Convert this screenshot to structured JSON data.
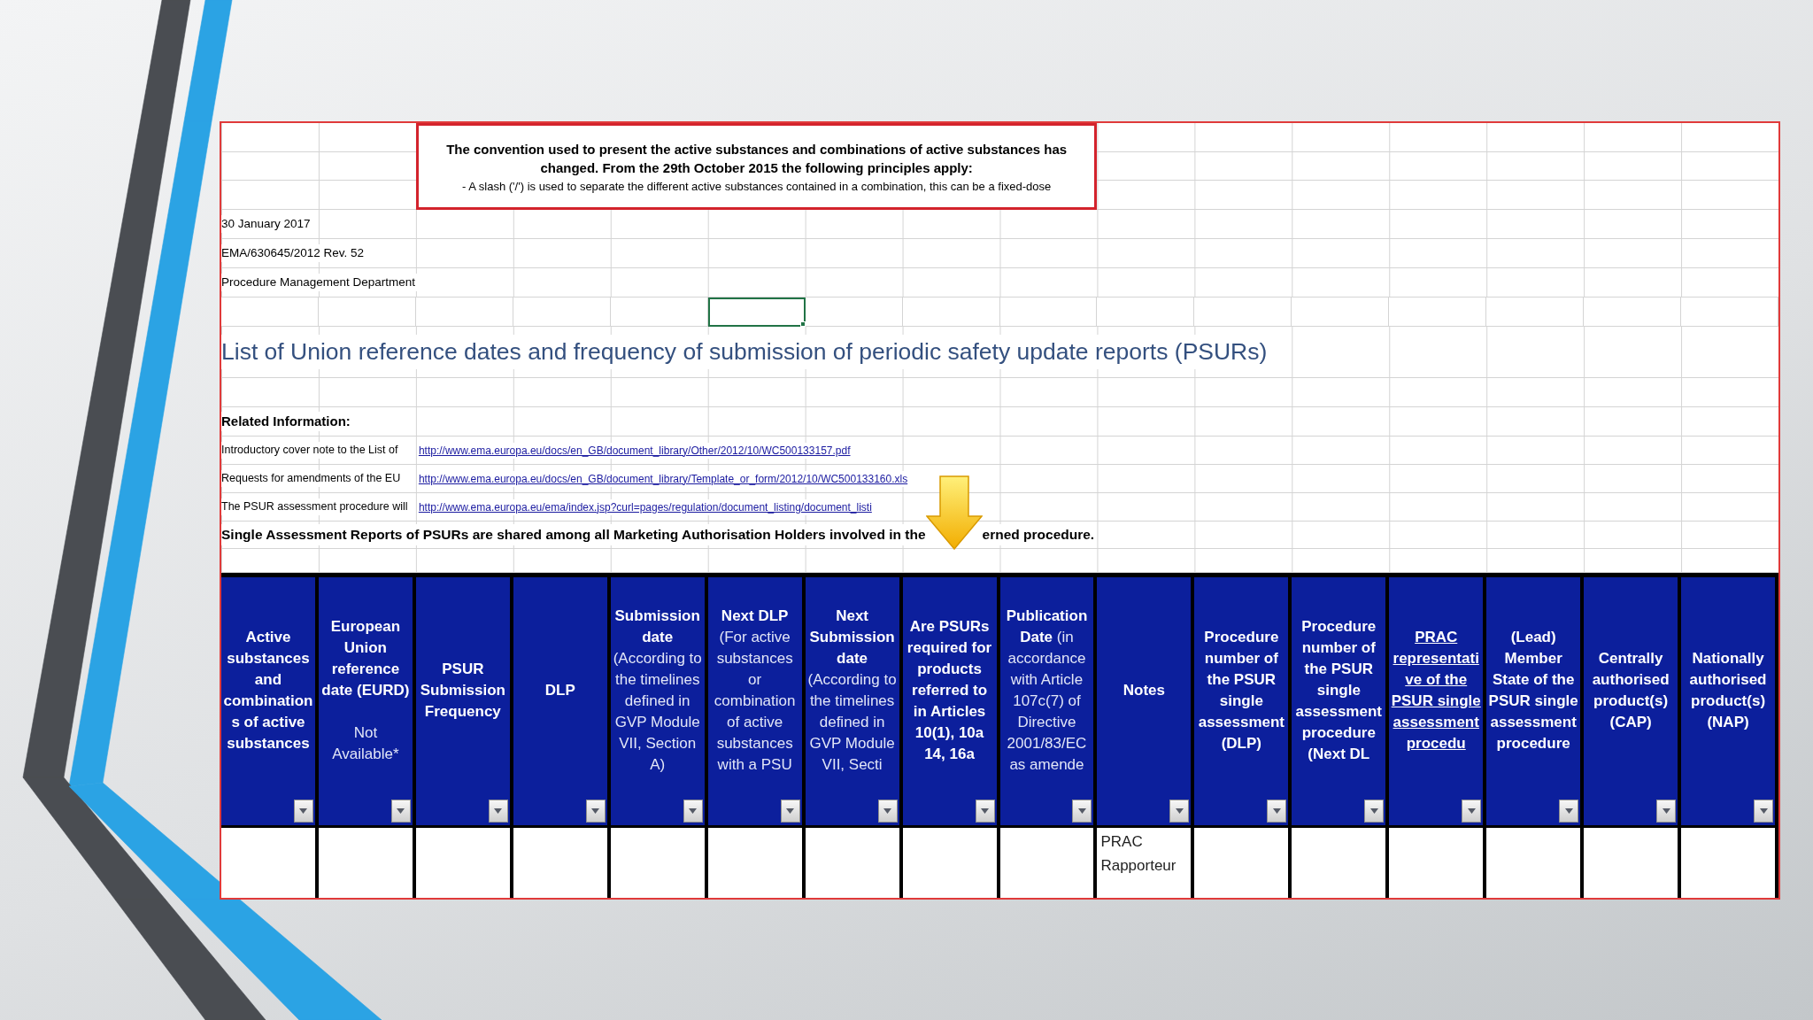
{
  "banner": {
    "heading": "The convention used to present the active substances and combinations of active substances has changed. From the 29th October 2015 the following principles apply:",
    "principle": "- A slash ('/') is used to separate the different active substances contained in a combination, this can be a fixed-dose"
  },
  "document_info": [
    "30 January 2017",
    "EMA/630645/2012 Rev. 52",
    "Procedure Management Department"
  ],
  "cursor_row": {
    "cells": [
      {
        "selected": false
      },
      {
        "selected": false
      },
      {
        "selected": false
      },
      {
        "selected": false
      },
      {
        "selected": false
      },
      {
        "selected": true
      },
      {
        "selected": false
      },
      {
        "selected": false
      },
      {
        "selected": false
      },
      {
        "selected": false
      },
      {
        "selected": false
      },
      {
        "selected": false
      },
      {
        "selected": false
      },
      {
        "selected": false
      },
      {
        "selected": false
      },
      {
        "selected": false
      }
    ]
  },
  "title": "List of Union reference dates and frequency of submission of periodic safety update reports (PSURs)",
  "related_information": {
    "heading": "Related Information:",
    "links": [
      {
        "label": "Introductory cover note to the List of",
        "url": "http://www.ema.europa.eu/docs/en_GB/document_library/Other/2012/10/WC500133157.pdf"
      },
      {
        "label": "Requests for amendments of the EU",
        "url": "http://www.ema.europa.eu/docs/en_GB/document_library/Template_or_form/2012/10/WC500133160.xls"
      },
      {
        "label": "The PSUR assessment procedure will",
        "url": "http://www.ema.europa.eu/ema/index.jsp?curl=pages/regulation/document_listing/document_listi"
      }
    ],
    "notice_segments": [
      "Single Assessment Reports of PSURs are shared among all Marketing Authorisation Holders involved in the",
      "erned procedure."
    ]
  },
  "table": {
    "columns": [
      {
        "title": "Active substances and combinations of active substances",
        "underlined": false
      },
      {
        "title": "European Union reference date (EURD)",
        "note": "Not Available*",
        "underlined": false
      },
      {
        "title": "PSUR Submission Frequency",
        "underlined": false
      },
      {
        "title": "DLP",
        "underlined": false
      },
      {
        "title": "Submission date",
        "detail": "(According to the timelines defined in GVP Module VII, Section A)",
        "underlined": false
      },
      {
        "title": "Next DLP",
        "detail": "(For active substances or combination of active substances with a PSU",
        "underlined": false
      },
      {
        "title": "Next Submission date",
        "detail": "(According to the timelines defined in GVP Module VII, Secti",
        "underlined": false
      },
      {
        "title": "Are PSURs required for products referred to in Articles 10(1), 10a 14, 16a",
        "underlined": false
      },
      {
        "title": "Publication Date",
        "detail": "(in accordance with Article 107c(7) of Directive 2001/83/EC as amende",
        "underlined": false
      },
      {
        "title": "Notes",
        "underlined": false
      },
      {
        "title": "Procedure number of the PSUR single assessment (DLP)",
        "underlined": false
      },
      {
        "title": "Procedure number of the PSUR single assessment procedure (Next DL",
        "underlined": false
      },
      {
        "title": "PRAC representative of the PSUR single assessment procedu",
        "underlined": true
      },
      {
        "title": "(Lead) Member State of the PSUR single assessment procedure",
        "underlined": false
      },
      {
        "title": "Centrally authorised product(s) (CAP)",
        "underlined": false
      },
      {
        "title": "Nationally authorised product(s) (NAP)",
        "underlined": false
      }
    ],
    "rows": [
      {
        "cells": [
          null,
          null,
          null,
          null,
          null,
          null,
          null,
          null,
          null,
          "PRAC Rapporteur",
          null,
          null,
          null,
          null,
          null,
          null
        ]
      }
    ]
  }
}
